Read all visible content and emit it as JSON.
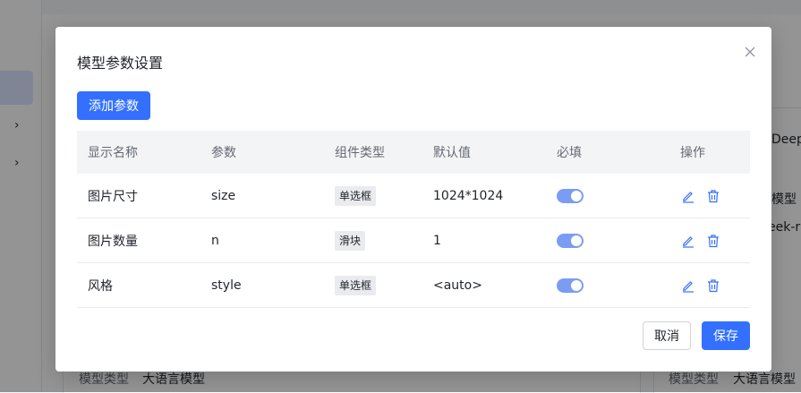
{
  "background": {
    "left_card_label": "模型类型",
    "left_card_value": "大语言模型",
    "right_card_label": "模型类型",
    "right_card_value": "大语言模型",
    "right_partial_1": "Deep",
    "right_partial_2": "模型",
    "right_partial_3": "eek-r"
  },
  "modal": {
    "title": "模型参数设置",
    "add_button": "添加参数",
    "columns": [
      "显示名称",
      "参数",
      "组件类型",
      "默认值",
      "必填",
      "操作"
    ],
    "rows": [
      {
        "name": "图片尺寸",
        "param": "size",
        "component": "单选框",
        "default": "1024*1024",
        "required": true
      },
      {
        "name": "图片数量",
        "param": "n",
        "component": "滑块",
        "default": "1",
        "required": true
      },
      {
        "name": "风格",
        "param": "style",
        "component": "单选框",
        "default": "<auto>",
        "required": true
      }
    ],
    "cancel_button": "取消",
    "save_button": "保存"
  },
  "colors": {
    "primary": "#3370ff",
    "switch_on": "#7b9cf3",
    "icon_blue": "#3370ff"
  },
  "icons": [
    "close-icon",
    "chevron-right-icon",
    "edit-icon",
    "delete-icon"
  ]
}
